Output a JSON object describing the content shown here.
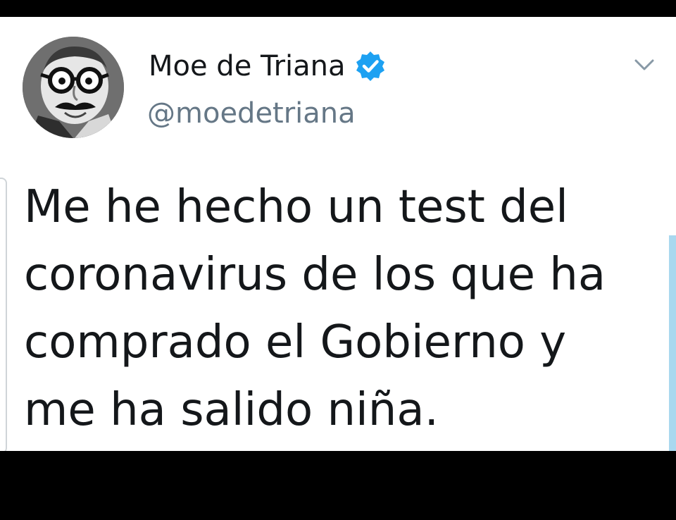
{
  "tweet": {
    "author": {
      "display_name": "Moe de Triana",
      "handle": "@moedetriana",
      "verified": true,
      "avatar_icon": "cartoon-face-with-glasses-and-mustache"
    },
    "menu_icon": "chevron-down-icon",
    "text": "Me he hecho un test del\ncoronavirus de los que ha\ncomprado el Gobierno y\nme ha salido niña."
  },
  "colors": {
    "background": "#ffffff",
    "text": "#14171a",
    "secondary_text": "#657786",
    "verified_blue": "#1da1f2",
    "chevron": "#8899a6"
  }
}
